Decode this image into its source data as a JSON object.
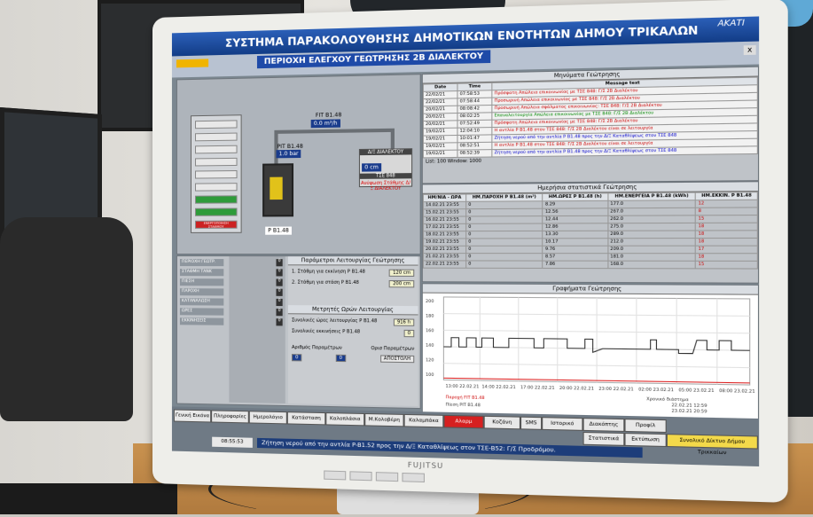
{
  "app": {
    "title": "ΣΥΣΤΗΜΑ ΠΑΡΑΚΟΛΟΥΘΗΣΗΣ ΔΗΜΟΤΙΚΩΝ ΕΝΟΤΗΤΩΝ ΔΗΜΟΥ ΤΡΙΚΑΛΩΝ",
    "logo": "ΑΚΑΤΙ",
    "close": "x"
  },
  "subheader": {
    "title": "ΠΕΡΙΟΧΗ ΕΛΕΓΧΟΥ ΓΕΩΤΡΗΣΗΣ 2Β ΔΙΑΛΕΚΤΟΥ"
  },
  "plant": {
    "flow_label": "FIT B1.48",
    "flow_value": "0.0 m³/h",
    "pressure_label": "PIT B1.48",
    "pressure_value": "1.0 bar",
    "tank_title": "Δ/Ξ ΔΙΑΛΕΚΤΟΥ",
    "tank_level": "0 cm",
    "tank_sub": "ΤΣΕ 848",
    "tank_alarm": "Ανύψωση Στάθμης Δ/Ξ ΔΙΑΛΕΚΤΟΥ",
    "pump_label": "P B1.48",
    "mode_label": "ΕΝΕΡΓΟΠΟΙΗΣΗ ΣΤΑΘΜΟΥ"
  },
  "events": {
    "header": "Μηνύματα Γεώτρησης",
    "columns": [
      "Date",
      "Time",
      "Message text"
    ],
    "rows": [
      [
        "22/02/21",
        "07:58:53",
        "Πρόσφατη Απώλεια επικοινωνίας με ΤΣΕ 848: Γ/Σ 2Β Διαλέκτου"
      ],
      [
        "22/02/21",
        "07:58:44",
        "Προσωρινή Απώλεια επικοινωνίας με ΤΣΕ 848: Γ/Σ 2Β Διαλέκτου"
      ],
      [
        "20/02/21",
        "08:08:42",
        "Προσωρινή Απώλεια σφάλματος επικοινωνίας: ΤΣΕ 848: Γ/Σ 2Β Διαλέκτου"
      ],
      [
        "20/02/21",
        "08:02:25",
        "Επαναλειτουργία Απώλεια επικοινωνίας με ΤΣΕ 848: Γ/Σ 2Β Διαλέκτου"
      ],
      [
        "20/02/21",
        "07:52:49",
        "Πρόσφατη Απώλεια επικοινωνίας με ΤΣΕ 848: Γ/Σ 2Β Διαλέκτου"
      ],
      [
        "19/02/21",
        "12:04:10",
        "Η αντλία P B1.48 στον ΤΣΕ 848: Γ/Σ 2Β Διαλέκτου είναι σε λειτουργία"
      ],
      [
        "19/02/21",
        "10:01:47",
        "Ζήτηση νερού από την αντλία P B1.48 προς την Δ/Ξ Καταθλίψεως στον ΤΣΕ 848"
      ],
      [
        "19/02/21",
        "08:52:51",
        "Η αντλία P B1.48 στον ΤΣΕ 848: Γ/Σ 2Β Διαλέκτου είναι σε λειτουργία"
      ],
      [
        "19/02/21",
        "08:52:39",
        "Ζήτηση νερού από την αντλία P B1.48 προς την Δ/Ξ Καταθλίψεως στον ΤΣΕ 848"
      ]
    ],
    "footer": "List: 100   Window: 1000"
  },
  "stats": {
    "header": "Ημερήσια στατιστικά Γεώτρησης",
    "columns": [
      "ΗΜ/ΝΙΑ - ΩΡΑ",
      "ΗΜ.ΠΑΡΟΧΗ P B1.48 (m³)",
      "ΗΜ.ΩΡΕΣ P B1.48 (h)",
      "ΗΜ.ΕΝΕΡΓΕΙΑ P B1.48 (kWh)",
      "ΗΜ.ΕΚΚΙΝ. P B1.48"
    ],
    "rows": [
      [
        "14.02.21 23:55",
        "0",
        "8.29",
        "177.0",
        "12"
      ],
      [
        "15.02.21 23:55",
        "0",
        "12.56",
        "267.0",
        "8"
      ],
      [
        "16.02.21 23:55",
        "0",
        "12.44",
        "262.0",
        "15"
      ],
      [
        "17.02.21 23:55",
        "0",
        "12.86",
        "275.0",
        "18"
      ],
      [
        "18.02.21 23:55",
        "0",
        "13.30",
        "289.0",
        "18"
      ],
      [
        "19.02.21 23:55",
        "0",
        "10.17",
        "212.0",
        "18"
      ],
      [
        "20.02.21 23:55",
        "0",
        "9.76",
        "209.0",
        "17"
      ],
      [
        "21.02.21 23:55",
        "0",
        "8.57",
        "181.0",
        "18"
      ],
      [
        "22.02.21 23:55",
        "0",
        "7.86",
        "168.0",
        "15"
      ]
    ]
  },
  "graph": {
    "header": "Γραφήματα Γεώτρησης",
    "time_labels": [
      "13:00\n22.02.21",
      "14:00\n22.02.21",
      "17:00\n22.02.21",
      "20:00\n22.02.21",
      "23:00\n22.02.21",
      "02:00\n23.02.21",
      "05:00\n23.02.21",
      "08:00\n23.02.21"
    ],
    "y_labels": [
      "200",
      "180",
      "160",
      "140",
      "120",
      "100"
    ],
    "legend1": "Παροχή FIT B1.48",
    "legend2": "Πίεση PIT B1.48",
    "range_from": "22.02.21 12:59",
    "range_to": "23.02.21 20:59",
    "range_label": "Χρονικό διάστημα"
  },
  "settings": {
    "header": "Παράμετροι Λειτουργίας Γεώτρησης",
    "start_label": "1. Στάθμη για εκκίνηση P B1.48",
    "start_value": "120 cm",
    "stop_label": "2. Στάθμη για στάση P B1.48",
    "stop_value": "200 cm",
    "counters_header": "Μετρητές Ωρών Λειτουργίας",
    "hours_label": "Συνολικές ώρες λειτουργίας P B1.48",
    "hours_value": "916 h",
    "starts_label": "Συνολικές εκκινήσεις P B1.48",
    "starts_value": "0",
    "param_label1": "Αριθμός Παραμέτρων",
    "param_value1": "0",
    "param_label2": "Ορισ Παραμέτρων",
    "param_value2": "0",
    "apply_btn": "ΑΠΟΣΤΟΛΗ"
  },
  "leftlist": {
    "items": [
      "ΠΕΡΙΟΧΗ ΓΕΩΤΡ.",
      "ΣΤΑΘΜΗ ΤΑΝΚ",
      "ΠΙΕΣΗ",
      "ΠΑΡΟΧΗ",
      "ΚΑΤΑΝΑΛΩΣΗ",
      "ΩΡΕΣ",
      "ΕΚΚΙΝΗΣΕΙΣ"
    ],
    "values": [
      "0",
      "0",
      "0",
      "0",
      "0",
      "0",
      "0"
    ]
  },
  "tabs": {
    "row1": [
      "Γενική Εικόνα",
      "Πληροφορίες",
      "Ημερολόγιο",
      "Κατάσταση",
      "Καλοπλάσια",
      "Μ.Κολοβέρη",
      "Καλαμπάκα",
      "Αλαρμ",
      "Κοζάνη",
      "SMS",
      "Ιστορικό"
    ],
    "row2": [
      "Διακόπτης",
      "Προφίλ",
      "Στατιστικά",
      "Εκτύπωση",
      "Συνολικό Δίκτυο Δήμου Τρικκαίων"
    ],
    "ticker": "Ζήτηση νερού από την αντλία P-B1.52 προς την Δ/Ξ Καταθλίψεως στον ΤΣΕ-B52: Γ/Σ Προδρόμου.",
    "time": "08:55:53"
  },
  "monitor": {
    "brand": "FUJITSU"
  }
}
